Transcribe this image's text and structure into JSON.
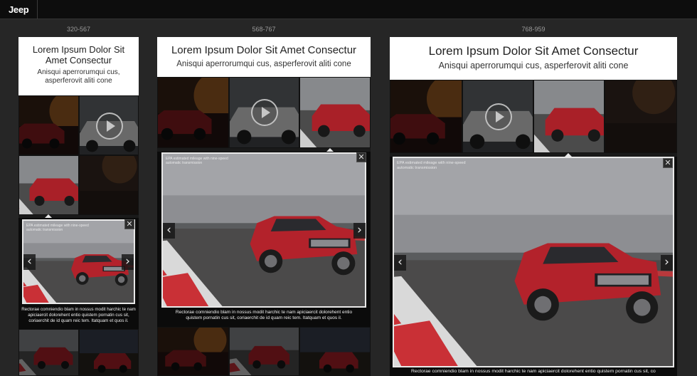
{
  "nav": {
    "brand": "Jeep"
  },
  "breakpoints": [
    "320-567",
    "568-767",
    "768-959"
  ],
  "header": {
    "title": "Lorem Ipsum Dolor Sit Amet Consectur",
    "subtitle": "Anisqui aperrorumqui cus, asperferovit aliti cone"
  },
  "modal": {
    "epa_note": "EPA estimated mileage with nine-speed automatic transmission",
    "caption": "Rectorae comniendio blam in nossus modit harchic te nam apiciaercit dolorehent entio quistem pornatin cus sit, coriaerchit de id quam reic tem. Itatquam et quos il.",
    "close_glyph": "✕",
    "prev_glyph": "‹",
    "next_glyph": "›"
  },
  "colors": {
    "accent": "#ffffff",
    "vehicle": "#b3222b",
    "background": "#262626"
  },
  "icons": [
    "jeep-logo",
    "play-icon",
    "close-icon",
    "chevron-left-icon",
    "chevron-right-icon"
  ]
}
